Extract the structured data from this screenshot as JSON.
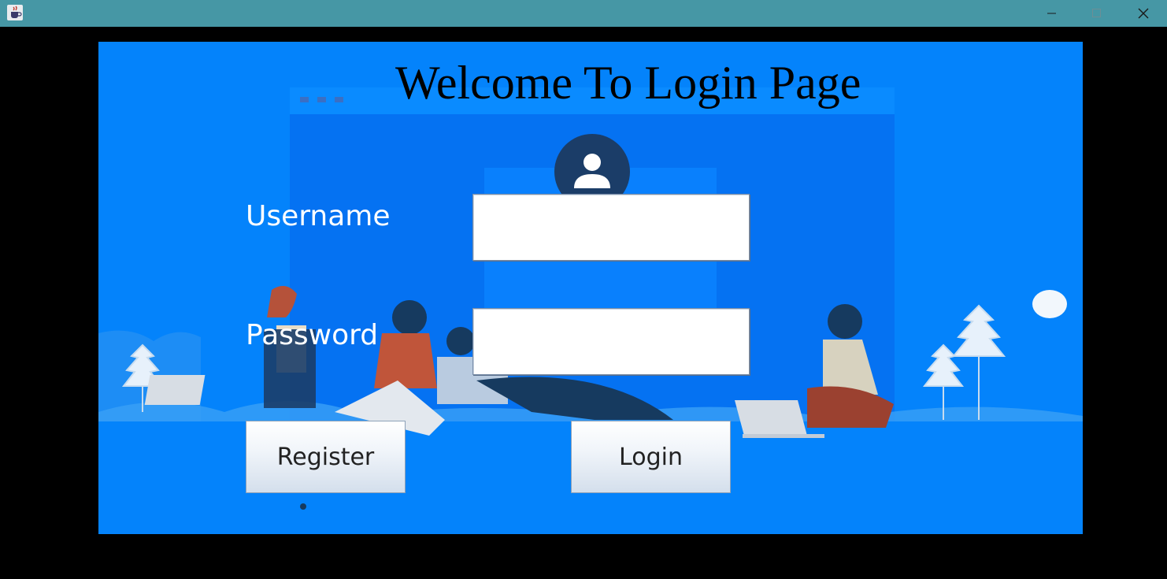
{
  "window": {
    "app_icon": "java-coffee-cup-icon",
    "controls": {
      "minimize_icon": "minimize-icon",
      "maximize_icon": "maximize-icon",
      "close_icon": "close-icon"
    }
  },
  "colors": {
    "titlebar": "#4697a5",
    "panel_background": "#0483fb",
    "heading_text": "#000000",
    "label_text": "#ffffff"
  },
  "login": {
    "heading": "Welcome To Login Page",
    "username_label": "Username",
    "username_value": "",
    "password_label": "Password",
    "password_value": "",
    "register_label": "Register",
    "login_label": "Login"
  },
  "illustration": {
    "avatar_icon": "user-avatar-icon"
  }
}
